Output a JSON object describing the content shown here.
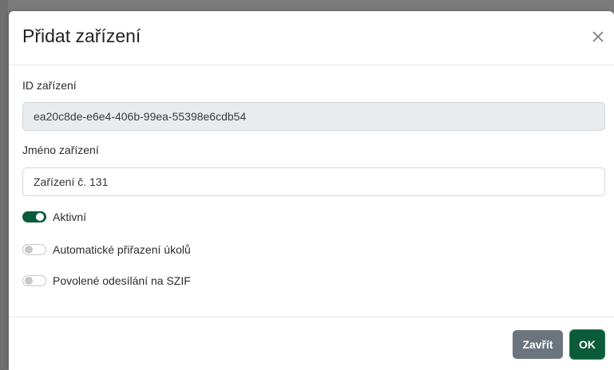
{
  "modal": {
    "title": "Přidat zařízení"
  },
  "form": {
    "device_id_label": "ID zařízení",
    "device_id_value": "ea20c8de-e6e4-406b-99ea-55398e6cdb54",
    "device_name_label": "Jméno zařízení",
    "device_name_value": "Zařízení č. 131"
  },
  "toggles": [
    {
      "label": "Aktivní",
      "checked": true
    },
    {
      "label": "Automatické přiřazení úkolů",
      "checked": false
    },
    {
      "label": "Povolené odesílání na SZIF",
      "checked": false
    }
  ],
  "footer": {
    "close_label": "Zavřít",
    "ok_label": "OK"
  },
  "colors": {
    "primary": "#0b5b3a",
    "secondary": "#6c757d",
    "readonly_bg": "#e9ecef"
  },
  "icons": {
    "close": "close-icon"
  }
}
